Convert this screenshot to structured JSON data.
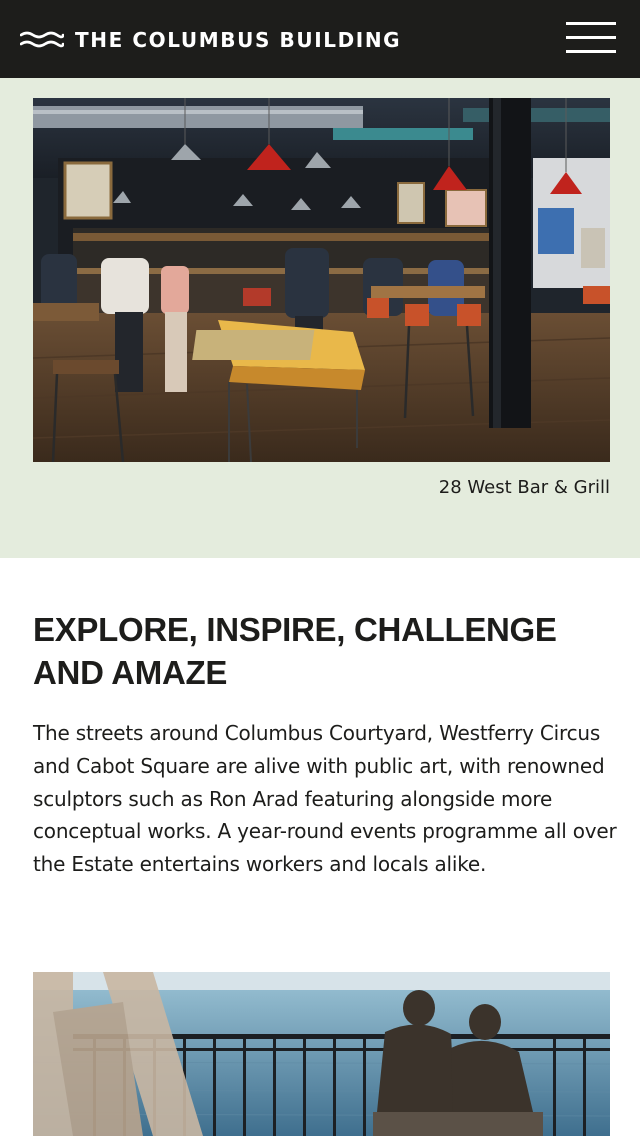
{
  "header": {
    "logo_icon": "wave-icon",
    "brand": "THE COLUMBUS BUILDING",
    "menu_icon": "hamburger-menu-icon"
  },
  "hero": {
    "caption": "28 West Bar & Grill"
  },
  "section": {
    "heading": "EXPLORE, INSPIRE, CHALLENGE AND AMAZE",
    "body": "The streets around Columbus Courtyard, Westferry Circus and Cabot Square are alive with public art, with renowned sculptors such as Ron Arad featuring alongside more conceptual works. A year-round events programme all over the Estate entertains workers and locals alike."
  },
  "colors": {
    "header_bg": "#1d1d1b",
    "hero_band": "#e4ecdd",
    "text": "#1d1d1b"
  }
}
